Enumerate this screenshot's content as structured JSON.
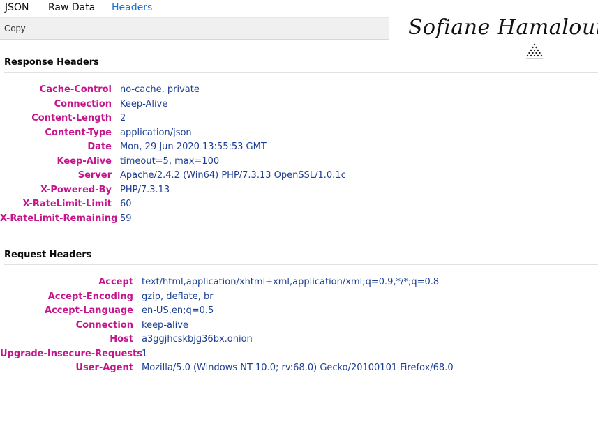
{
  "tabs": [
    {
      "label": "JSON",
      "active": false
    },
    {
      "label": "Raw Data",
      "active": false
    },
    {
      "label": "Headers",
      "active": true
    }
  ],
  "toolbar": {
    "copy_label": "Copy"
  },
  "signature": {
    "text": "Sofiane Hamaloui"
  },
  "response": {
    "title": "Response Headers",
    "rows": [
      {
        "name": "Cache-Control",
        "value": "no-cache, private"
      },
      {
        "name": "Connection",
        "value": "Keep-Alive"
      },
      {
        "name": "Content-Length",
        "value": "2"
      },
      {
        "name": "Content-Type",
        "value": "application/json"
      },
      {
        "name": "Date",
        "value": "Mon, 29 Jun 2020 13:55:53 GMT"
      },
      {
        "name": "Keep-Alive",
        "value": "timeout=5, max=100"
      },
      {
        "name": "Server",
        "value": "Apache/2.4.2 (Win64) PHP/7.3.13 OpenSSL/1.0.1c"
      },
      {
        "name": "X-Powered-By",
        "value": "PHP/7.3.13"
      },
      {
        "name": "X-RateLimit-Limit",
        "value": "60"
      },
      {
        "name": "X-RateLimit-Remaining",
        "value": "59"
      }
    ]
  },
  "request": {
    "title": "Request Headers",
    "rows": [
      {
        "name": "Accept",
        "value": "text/html,application/xhtml+xml,application/xml;q=0.9,*/*;q=0.8"
      },
      {
        "name": "Accept-Encoding",
        "value": "gzip, deflate, br"
      },
      {
        "name": "Accept-Language",
        "value": "en-US,en;q=0.5"
      },
      {
        "name": "Connection",
        "value": "keep-alive"
      },
      {
        "name": "Host",
        "value": "a3ggjhcskbjg36bx.onion"
      },
      {
        "name": "Upgrade-Insecure-Requests",
        "value": "1"
      },
      {
        "name": "User-Agent",
        "value": "Mozilla/5.0 (Windows NT 10.0; rv:68.0) Gecko/20100101 Firefox/68.0"
      }
    ]
  },
  "colors": {
    "header_name": "#c5148c",
    "header_value": "#1c3f94",
    "active_tab": "#1a6fd1",
    "toolbar_bg": "#f0f0f0"
  }
}
